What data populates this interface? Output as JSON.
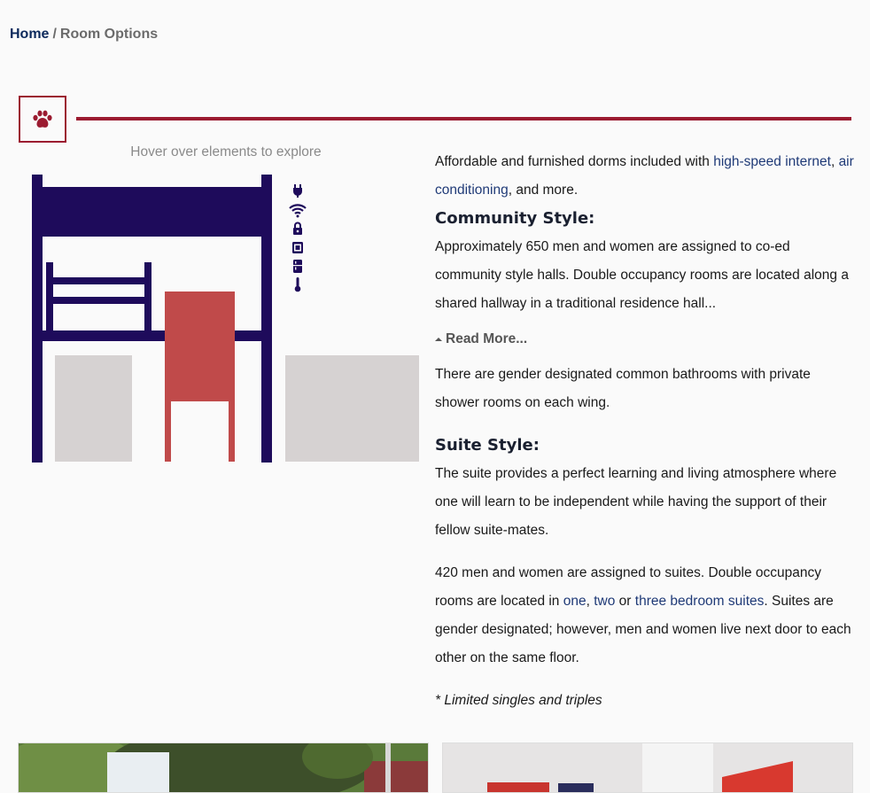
{
  "breadcrumb": {
    "home": "Home",
    "separator": "/",
    "current": "Room Options"
  },
  "section_icon": "paw-icon",
  "explorer": {
    "hint": "Hover over elements to explore",
    "amenity_icons": [
      "plug-icon",
      "wifi-icon",
      "lock-icon",
      "microwave-icon",
      "fridge-icon",
      "thermometer-icon"
    ]
  },
  "colors": {
    "accent": "#9b1b30",
    "navy": "#1e0b5b",
    "chair": "#c04a4a",
    "furniture_gray": "#d6d2d2",
    "link": "#1f3a77"
  },
  "intro": {
    "text_before": "Affordable and furnished dorms included with ",
    "link_internet": "high-speed internet",
    "comma": ",",
    "link_ac": "air conditioning",
    "text_after": ", and more."
  },
  "community": {
    "heading": "Community Style:",
    "paragraph": "Approximately 650 men and women are assigned to co-ed community style halls. Double occupancy rooms are located along a shared hallway in a traditional residence hall...",
    "read_more": "Read More...",
    "bathrooms": "There are gender designated common bathrooms with private shower rooms on each wing."
  },
  "suite": {
    "heading": "Suite Style:",
    "paragraph1": "The suite provides a perfect learning and living atmosphere where one will learn to be independent while having the support of their fellow suite-mates.",
    "p2_before": "420 men and women are assigned to suites. Double occupancy rooms are located in ",
    "link_one": "one",
    "sep1": ", ",
    "link_two": "two",
    "sep2": " or ",
    "link_three": "three bedroom suites",
    "p2_after": ". Suites are gender designated; however, men and women live next door to each other on the same floor.",
    "note": "* Limited singles and triples"
  }
}
